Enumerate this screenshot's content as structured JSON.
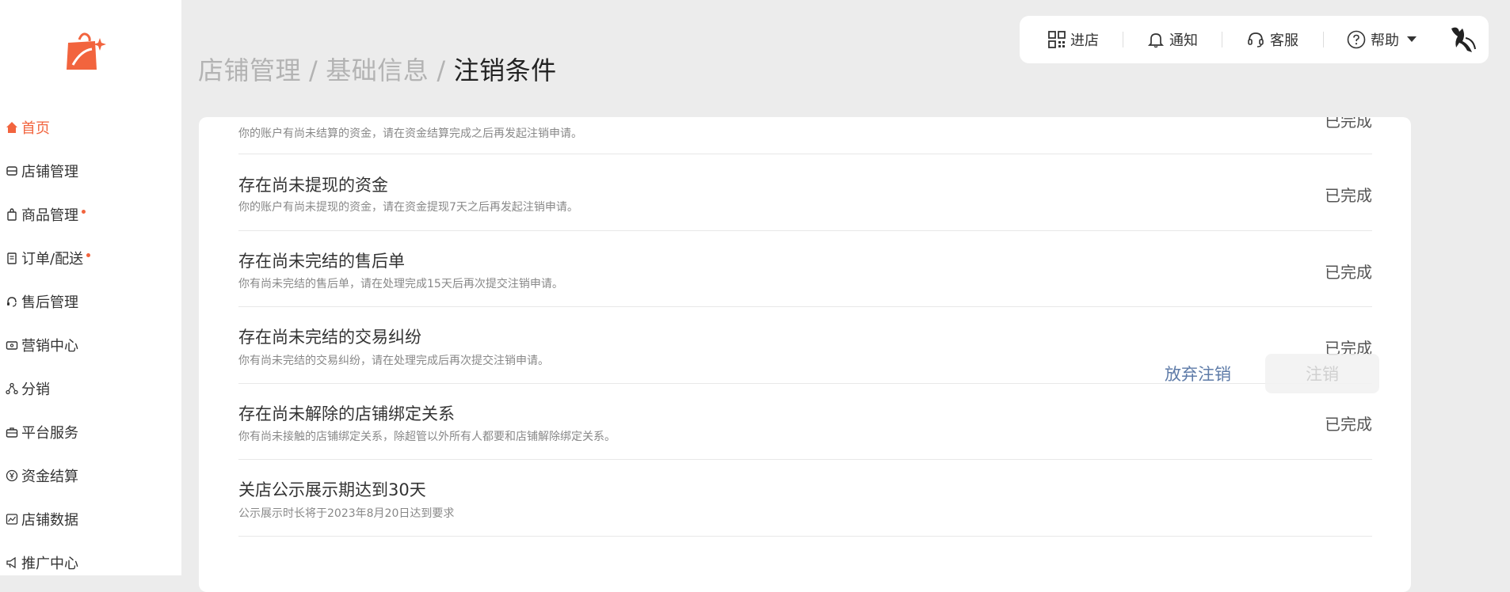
{
  "sidebar": {
    "items": [
      {
        "label": "首页",
        "icon": "home-icon",
        "active": true,
        "dot": false
      },
      {
        "label": "店铺管理",
        "icon": "store-icon",
        "active": false,
        "dot": false
      },
      {
        "label": "商品管理",
        "icon": "bag-icon",
        "active": false,
        "dot": true
      },
      {
        "label": "订单/配送",
        "icon": "order-icon",
        "active": false,
        "dot": true
      },
      {
        "label": "售后管理",
        "icon": "headset-icon",
        "active": false,
        "dot": false
      },
      {
        "label": "营销中心",
        "icon": "ticket-icon",
        "active": false,
        "dot": false
      },
      {
        "label": "分销",
        "icon": "share-icon",
        "active": false,
        "dot": false
      },
      {
        "label": "平台服务",
        "icon": "briefcase-icon",
        "active": false,
        "dot": false
      },
      {
        "label": "资金结算",
        "icon": "yen-icon",
        "active": false,
        "dot": false
      },
      {
        "label": "店铺数据",
        "icon": "chart-icon",
        "active": false,
        "dot": false
      },
      {
        "label": "推广中心",
        "icon": "megaphone-icon",
        "active": false,
        "dot": false
      }
    ]
  },
  "breadcrumb": {
    "items": [
      "店铺管理",
      "基础信息"
    ],
    "separator": "/",
    "current": "注销条件"
  },
  "topbar": {
    "store": "进店",
    "notify": "通知",
    "service": "客服",
    "help": "帮助"
  },
  "conditions": [
    {
      "title": "",
      "desc": "你的账户有尚未结算的资金，请在资金结算完成之后再发起注销申请。",
      "status": "已完成"
    },
    {
      "title": "存在尚未提现的资金",
      "desc": "你的账户有尚未提现的资金，请在资金提现7天之后再发起注销申请。",
      "status": "已完成"
    },
    {
      "title": "存在尚未完结的售后单",
      "desc": "你有尚未完结的售后单，请在处理完成15天后再次提交注销申请。",
      "status": "已完成"
    },
    {
      "title": "存在尚未完结的交易纠纷",
      "desc": "你有尚未完结的交易纠纷，请在处理完成后再次提交注销申请。",
      "status": "已完成"
    },
    {
      "title": "存在尚未解除的店铺绑定关系",
      "desc": "你有尚未接触的店铺绑定关系，除超管以外所有人都要和店铺解除绑定关系。",
      "status": "已完成"
    },
    {
      "title": "关店公示展示期达到30天",
      "desc": "公示展示时长将于2023年8月20日达到要求",
      "status": ""
    }
  ],
  "actions": {
    "abandon": "放弃注销",
    "cancel": "注销"
  },
  "colors": {
    "accent": "#f2643e",
    "link": "#5e7ba8",
    "background": "#ececec"
  }
}
